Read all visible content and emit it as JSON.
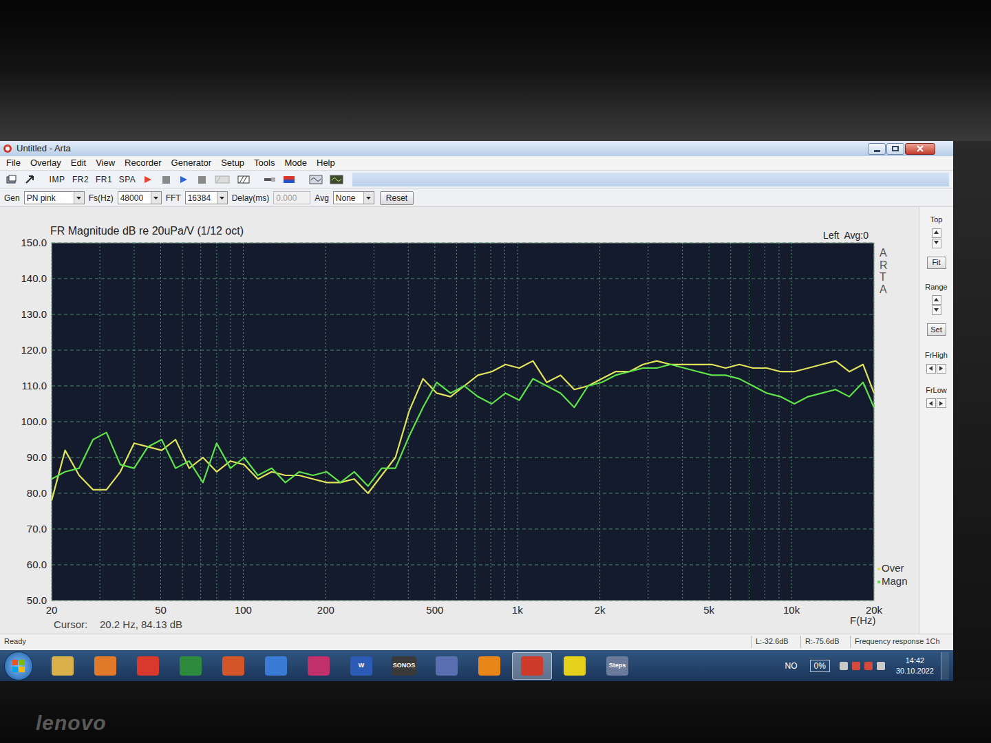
{
  "window": {
    "title": "Untitled - Arta"
  },
  "menu": [
    "File",
    "Overlay",
    "Edit",
    "View",
    "Recorder",
    "Generator",
    "Setup",
    "Tools",
    "Mode",
    "Help"
  ],
  "toolbar": {
    "text_buttons": [
      "IMP",
      "FR2",
      "FR1",
      "SPA"
    ]
  },
  "params": {
    "gen_label": "Gen",
    "gen_value": "PN pink",
    "fs_label": "Fs(Hz)",
    "fs_value": "48000",
    "fft_label": "FFT",
    "fft_value": "16384",
    "delay_label": "Delay(ms)",
    "delay_value": "0.000",
    "delay_disabled": true,
    "avg_label": "Avg",
    "avg_value": "None",
    "reset": "Reset"
  },
  "chart": {
    "title": "FR Magnitude dB re 20uPa/V (1/12 oct)",
    "channel": "Left  Avg:0",
    "brand": "ARTA",
    "y_ticks": [
      "150.0",
      "140.0",
      "130.0",
      "120.0",
      "110.0",
      "100.0",
      "90.0",
      "80.0",
      "70.0",
      "60.0",
      "50.0"
    ],
    "x_ticks": [
      {
        "label": "20",
        "hz": 20
      },
      {
        "label": "50",
        "hz": 50
      },
      {
        "label": "100",
        "hz": 100
      },
      {
        "label": "200",
        "hz": 200
      },
      {
        "label": "500",
        "hz": 500
      },
      {
        "label": "1k",
        "hz": 1000
      },
      {
        "label": "2k",
        "hz": 2000
      },
      {
        "label": "5k",
        "hz": 5000
      },
      {
        "label": "10k",
        "hz": 10000
      },
      {
        "label": "20k",
        "hz": 20000
      }
    ],
    "x_axis_label": "F(Hz)",
    "cursor_label": "Cursor:",
    "cursor_value": "20.2 Hz, 84.13 dB",
    "frequencies_hz": [
      20,
      22.4,
      25.2,
      28.3,
      31.7,
      35.6,
      40,
      44.9,
      50.4,
      56.6,
      63.5,
      71.3,
      80,
      89.8,
      100.8,
      113.1,
      127,
      142.5,
      160,
      179.6,
      201.6,
      226.3,
      254,
      285.1,
      320,
      359.2,
      403.2,
      452.5,
      508,
      570.2,
      640,
      718.4,
      806.3,
      905.1,
      1016,
      1140,
      1280,
      1437,
      1613,
      1810,
      2032,
      2281,
      2560,
      2874,
      3225,
      3620,
      4064,
      4561,
      5120,
      5747,
      6451,
      7241,
      8127,
      9123,
      10240,
      11494,
      12902,
      14482,
      16255,
      18246,
      20000
    ],
    "series": [
      {
        "name": "Over",
        "color": "#e2e35c",
        "values": [
          78,
          92,
          85,
          81,
          81,
          86,
          94,
          93,
          92,
          95,
          87,
          90,
          86,
          89,
          88,
          84,
          86,
          85,
          85,
          84,
          83,
          83,
          84,
          80,
          85,
          90,
          103,
          112,
          108,
          107,
          110,
          113,
          114,
          116,
          115,
          117,
          111,
          113,
          109,
          110,
          112,
          114,
          114,
          116,
          117,
          116,
          116,
          116,
          116,
          115,
          116,
          115,
          115,
          114,
          114,
          115,
          116,
          117,
          114,
          116,
          108
        ]
      },
      {
        "name": "Magn",
        "color": "#5fe34a",
        "values": [
          84,
          86,
          87,
          95,
          97,
          88,
          87,
          93,
          95,
          87,
          89,
          83,
          94,
          87,
          90,
          85,
          87,
          83,
          86,
          85,
          86,
          83,
          86,
          82,
          87,
          87,
          96,
          104,
          111,
          108,
          110,
          107,
          105,
          108,
          106,
          112,
          110,
          108,
          104,
          110,
          111,
          113,
          114,
          115,
          115,
          116,
          115,
          114,
          113,
          113,
          112,
          110,
          108,
          107,
          105,
          107,
          108,
          109,
          107,
          111,
          104
        ]
      }
    ]
  },
  "side_panel": {
    "top": "Top",
    "fit": "Fit",
    "range": "Range",
    "set": "Set",
    "fr_high": "FrHigh",
    "fr_low": "FrLow"
  },
  "status_bar": {
    "left": "Ready",
    "cells": [
      "L:-32.6dB",
      "R:-75.6dB",
      "Frequency response 1Ch"
    ]
  },
  "taskbar": {
    "apps": [
      {
        "color": "#d9b04a",
        "selected": false
      },
      {
        "color": "#e07a2a",
        "selected": false
      },
      {
        "color": "#d8392b",
        "selected": false
      },
      {
        "color": "#2e8b3e",
        "selected": false
      },
      {
        "color": "#d2562a",
        "selected": false
      },
      {
        "color": "#3a7bd5",
        "selected": false
      },
      {
        "color": "#c0306a",
        "selected": false
      },
      {
        "color": "#2b5bb5",
        "label": "W",
        "selected": false
      },
      {
        "color": "#3a3a3a",
        "label": "SONOS",
        "selected": false
      },
      {
        "color": "#5a6fb0",
        "selected": false
      },
      {
        "color": "#e8861a",
        "selected": false
      },
      {
        "color": "#d03a2a",
        "selected": true
      },
      {
        "color": "#e6d21a",
        "selected": false
      },
      {
        "color": "#6a7a9a",
        "label": "Steps",
        "selected": false
      }
    ],
    "language": "NO",
    "battery": "0%",
    "time": "14:42",
    "date": "30.10.2022"
  },
  "bezel": {
    "logo": "lenovo"
  }
}
